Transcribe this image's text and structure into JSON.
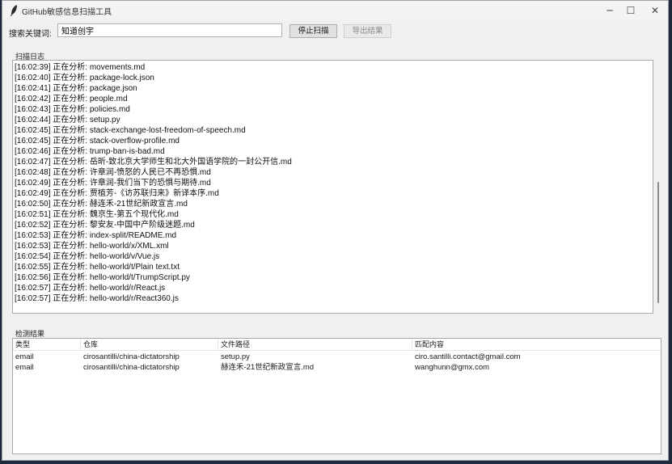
{
  "window": {
    "title": "GitHub敏感信息扫描工具",
    "minimize_glyph": "─",
    "maximize_glyph": "☐",
    "close_glyph": "✕"
  },
  "search": {
    "label": "搜索关键词:",
    "value": "知道创宇"
  },
  "buttons": {
    "stop": "停止扫描",
    "export": "导出结果"
  },
  "log": {
    "title": "扫描日志",
    "lines": [
      "[16:02:39] 正在分析: movements.md",
      "[16:02:40] 正在分析: package-lock.json",
      "[16:02:41] 正在分析: package.json",
      "[16:02:42] 正在分析: people.md",
      "[16:02:43] 正在分析: policies.md",
      "[16:02:44] 正在分析: setup.py",
      "[16:02:45] 正在分析: stack-exchange-lost-freedom-of-speech.md",
      "[16:02:45] 正在分析: stack-overflow-profile.md",
      "[16:02:46] 正在分析: trump-ban-is-bad.md",
      "[16:02:47] 正在分析: 岳昕-致北京大学师生和北大外国语学院的一封公开信.md",
      "[16:02:48] 正在分析: 许章润-愤怒的人民已不再恐惧.md",
      "[16:02:49] 正在分析: 许章润-我们当下的恐惧与期待.md",
      "[16:02:49] 正在分析: 贾植芳-《访苏联归来》新译本序.md",
      "[16:02:50] 正在分析: 赫连禾-21世纪新政宣言.md",
      "[16:02:51] 正在分析: 魏京生-第五个现代化.md",
      "[16:02:52] 正在分析: 黎安友-中国中产阶级迷题.md",
      "[16:02:53] 正在分析: index-split/README.md",
      "[16:02:53] 正在分析: hello-world/x/XML.xml",
      "[16:02:54] 正在分析: hello-world/v/Vue.js",
      "[16:02:55] 正在分析: hello-world/t/Plain text.txt",
      "[16:02:56] 正在分析: hello-world/t/TrumpScript.py",
      "[16:02:57] 正在分析: hello-world/r/React.js",
      "[16:02:57] 正在分析: hello-world/r/React360.js"
    ]
  },
  "results": {
    "title": "检测结果",
    "columns": [
      "类型",
      "仓库",
      "文件路径",
      "匹配内容"
    ],
    "rows": [
      [
        "email",
        "cirosantilli/china-dictatorship",
        "setup.py",
        "ciro.santilli.contact@gmail.com"
      ],
      [
        "email",
        "cirosantilli/china-dictatorship",
        "赫连禾-21世纪新政宣言.md",
        "wanghunn@gmx.com"
      ]
    ]
  }
}
